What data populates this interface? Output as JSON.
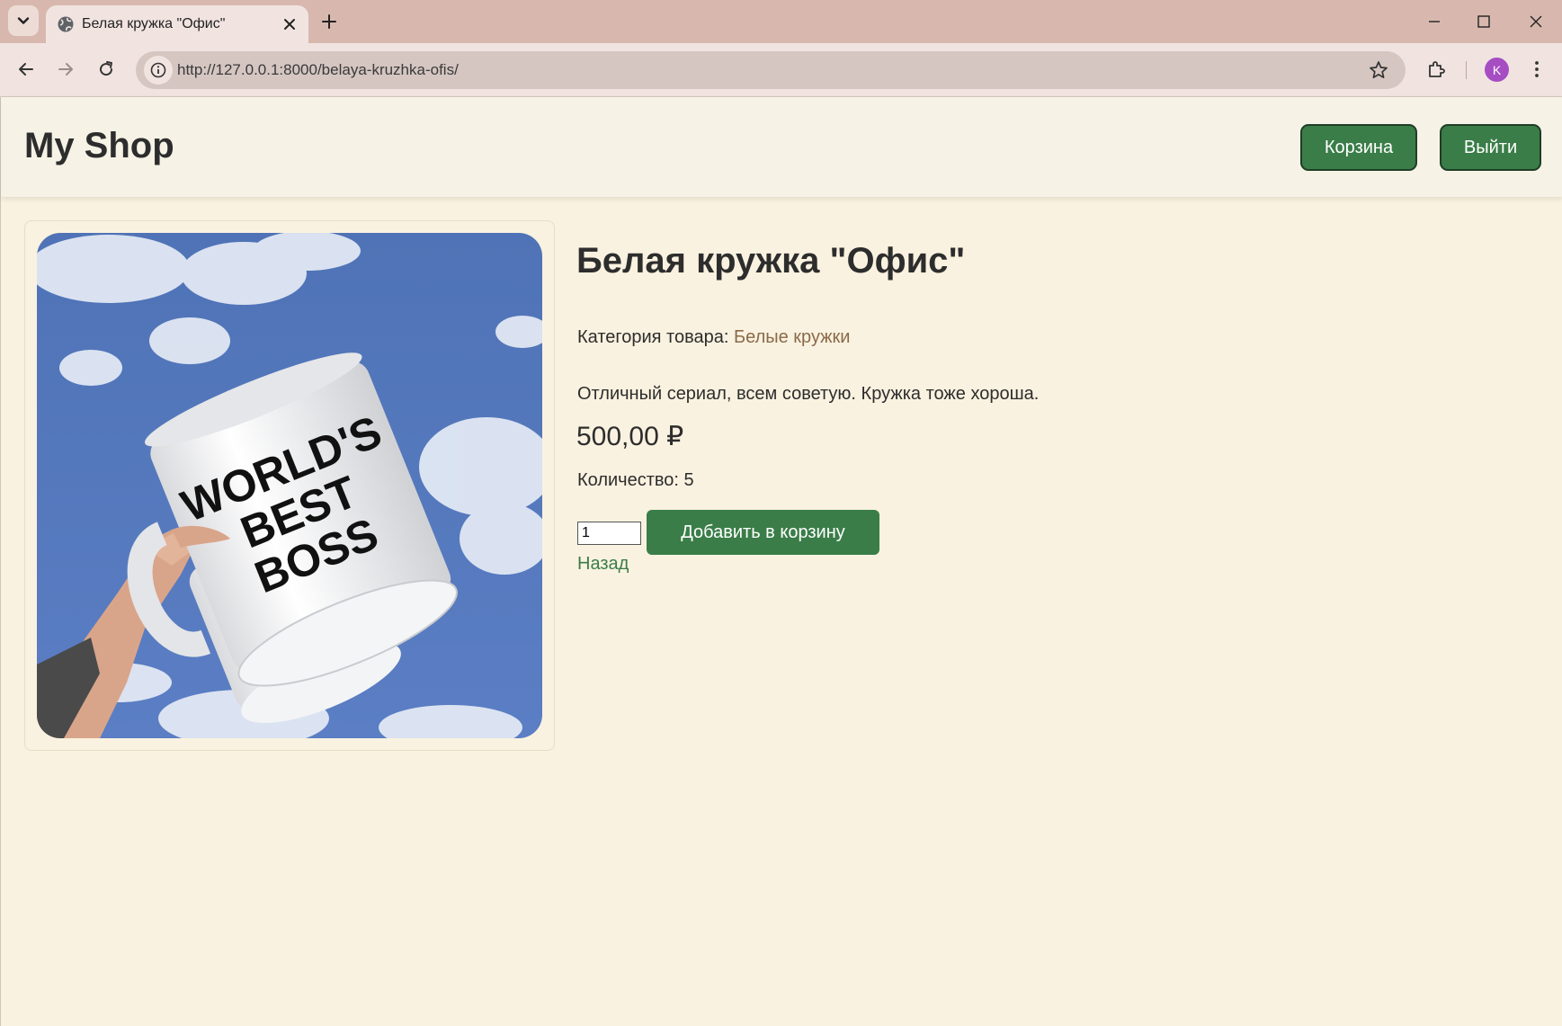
{
  "browser": {
    "tab_title": "Белая кружка \"Офис\"",
    "url": "http://127.0.0.1:8000/belaya-kruzhka-ofis/",
    "profile_initial": "K",
    "profile_color": "#a64dc4"
  },
  "header": {
    "brand": "My Shop",
    "cart_label": "Корзина",
    "logout_label": "Выйти"
  },
  "product": {
    "title": "Белая кружка \"Офис\"",
    "category_prefix": "Категория товара:",
    "category_name": "Белые кружки",
    "description": "Отличный сериал, всем советую. Кружка тоже хороша.",
    "price": "500,00 ₽",
    "stock_label": "Количество: 5",
    "quantity_value": "1",
    "add_to_cart_label": "Добавить в корзину",
    "back_label": "Назад",
    "image": {
      "mug_text_line1": "WORLD'S",
      "mug_text_line2": "BEST",
      "mug_text_line3": "BOSS"
    }
  },
  "colors": {
    "accent_green": "#3a7d48",
    "page_bg": "#faf2e0",
    "header_bg": "#f6f2e6"
  }
}
